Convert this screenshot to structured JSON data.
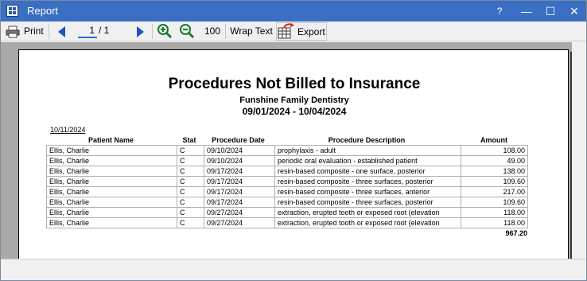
{
  "window": {
    "title": "Report",
    "help": "?",
    "minimize": "—",
    "maximize": "☐",
    "close": "✕"
  },
  "toolbar": {
    "print_label": "Print",
    "page_current": "1",
    "page_total": "/ 1",
    "zoom_level": "100",
    "wrap_text_label": "Wrap Text",
    "export_label": "Export"
  },
  "report": {
    "title": "Procedures Not Billed to Insurance",
    "practice": "Funshine Family Dentistry",
    "date_range": "09/01/2024 - 10/04/2024",
    "run_date": "10/11/2024",
    "columns": [
      "Patient Name",
      "Stat",
      "Procedure Date",
      "Procedure Description",
      "Amount"
    ],
    "rows": [
      [
        "Ellis, Charlie",
        "C",
        "09/10/2024",
        "prophylaxis - adult",
        "108.00"
      ],
      [
        "Ellis, Charlie",
        "C",
        "09/10/2024",
        "periodic oral evaluation - established patient",
        "49.00"
      ],
      [
        "Ellis, Charlie",
        "C",
        "09/17/2024",
        "resin-based composite - one surface, posterior",
        "138.00"
      ],
      [
        "Ellis, Charlie",
        "C",
        "09/17/2024",
        "resin-based composite - three surfaces, posterior",
        "109.60"
      ],
      [
        "Ellis, Charlie",
        "C",
        "09/17/2024",
        "resin-based composite - three surfaces, anterior",
        "217.00"
      ],
      [
        "Ellis, Charlie",
        "C",
        "09/17/2024",
        "resin-based composite - three surfaces, posterior",
        "109.60"
      ],
      [
        "Ellis, Charlie",
        "C",
        "09/27/2024",
        "extraction, erupted tooth or exposed root (elevation",
        "118.00"
      ],
      [
        "Ellis, Charlie",
        "C",
        "09/27/2024",
        "extraction, erupted tooth or exposed root (elevation",
        "118.00"
      ]
    ],
    "total": "967.20"
  }
}
